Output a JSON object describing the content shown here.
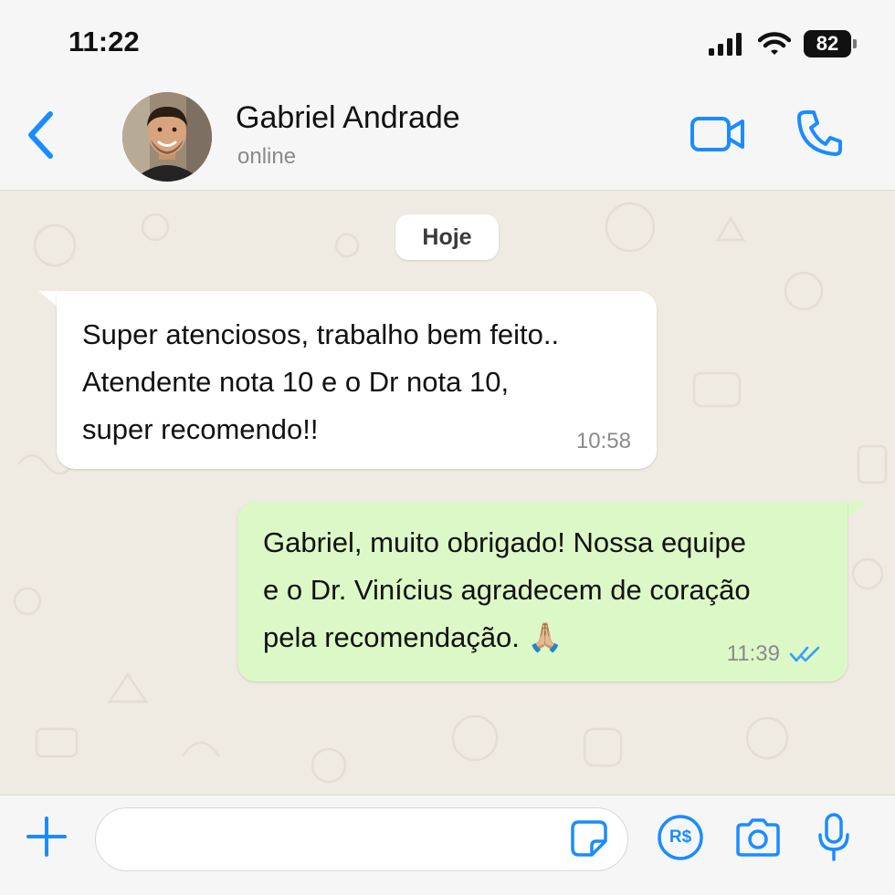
{
  "status_bar": {
    "time": "11:22",
    "battery": "82"
  },
  "header": {
    "contact_name": "Gabriel Andrade",
    "contact_status": "online"
  },
  "chat": {
    "date_label": "Hoje",
    "messages": [
      {
        "direction": "incoming",
        "text": "Super atenciosos, trabalho bem feito..\nAtendente nota 10 e o Dr nota 10,\nsuper recomendo!!",
        "time": "10:58"
      },
      {
        "direction": "outgoing",
        "text": "Gabriel, muito obrigado! Nossa equipe\ne o Dr. Vinícius agradecem de coração\npela recomendação. 🙏🏼",
        "time": "11:39",
        "status": "read"
      }
    ]
  },
  "input_bar": {
    "placeholder": "",
    "pix_label": "R$"
  },
  "colors": {
    "accent": "#1a8cff",
    "outgoing_bubble": "#dcf8c6",
    "read_ticks": "#34a0ff"
  },
  "icons": [
    "signal-icon",
    "wifi-icon",
    "battery-icon",
    "back-chevron-icon",
    "video-call-icon",
    "phone-icon",
    "plus-icon",
    "sticker-icon",
    "pix-icon",
    "camera-icon",
    "microphone-icon",
    "double-check-icon"
  ]
}
